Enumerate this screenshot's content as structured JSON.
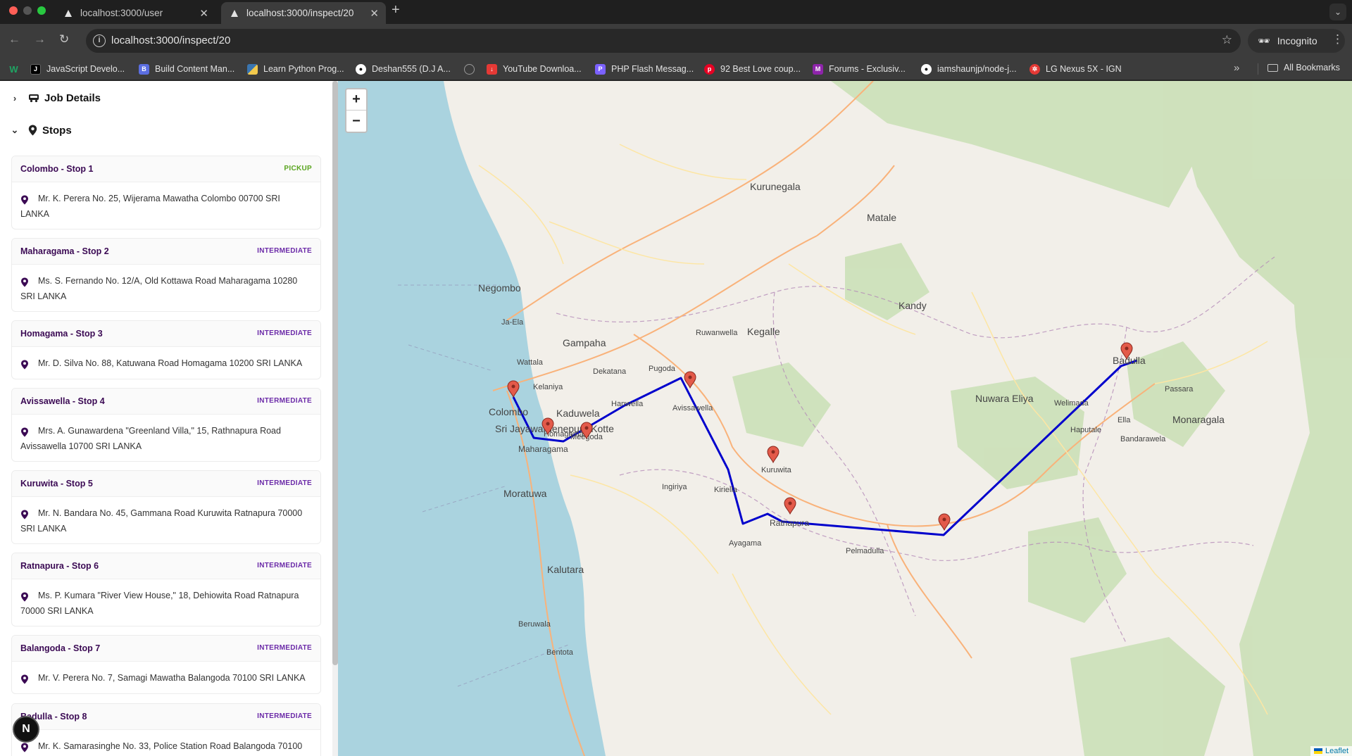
{
  "browser": {
    "tabs": [
      {
        "title": "localhost:3000/user",
        "active": false
      },
      {
        "title": "localhost:3000/inspect/20",
        "active": true
      }
    ],
    "url": "localhost:3000/inspect/20",
    "profile": "Incognito",
    "bookmarks": [
      {
        "label": "",
        "icon": "w-icon",
        "color": "#1fa463"
      },
      {
        "label": "JavaScript Develo...",
        "icon": "js-icon",
        "color": "#000000"
      },
      {
        "label": "Build Content Man...",
        "icon": "build-icon",
        "color": "#5b6ee1"
      },
      {
        "label": "Learn Python Prog...",
        "icon": "python-icon",
        "color": "#f2c94c"
      },
      {
        "label": "Deshan555 (D.J A...",
        "icon": "github-icon",
        "color": "#ffffff"
      },
      {
        "label": "",
        "icon": "globe-icon",
        "color": "#9a9a9a"
      },
      {
        "label": "YouTube Downloa...",
        "icon": "download-icon",
        "color": "#e53935"
      },
      {
        "label": "PHP Flash Messag...",
        "icon": "php-icon",
        "color": "#7b61ff"
      },
      {
        "label": "92 Best Love coup...",
        "icon": "pinterest-icon",
        "color": "#e60023"
      },
      {
        "label": "Forums - Exclusiv...",
        "icon": "m-icon",
        "color": "#8e24aa"
      },
      {
        "label": "iamshaunjp/node-j...",
        "icon": "github-icon",
        "color": "#ffffff"
      },
      {
        "label": "LG Nexus 5X - IGN",
        "icon": "ign-icon",
        "color": "#e53935"
      }
    ],
    "all_bookmarks": "All Bookmarks"
  },
  "sidebar": {
    "job_details_label": "Job Details",
    "stops_label": "Stops",
    "stops": [
      {
        "title": "Colombo - Stop 1",
        "badge": "PICKUP",
        "address": "Mr. K. Perera No. 25, Wijerama Mawatha Colombo 00700 SRI LANKA"
      },
      {
        "title": "Maharagama - Stop 2",
        "badge": "INTERMEDIATE",
        "address": "Ms. S. Fernando No. 12/A, Old Kottawa Road Maharagama 10280 SRI LANKA"
      },
      {
        "title": "Homagama - Stop 3",
        "badge": "INTERMEDIATE",
        "address": "Mr. D. Silva No. 88, Katuwana Road Homagama 10200 SRI LANKA"
      },
      {
        "title": "Avissawella - Stop 4",
        "badge": "INTERMEDIATE",
        "address": "Mrs. A. Gunawardena \"Greenland Villa,\" 15, Rathnapura Road Avissawella 10700 SRI LANKA"
      },
      {
        "title": "Kuruwita - Stop 5",
        "badge": "INTERMEDIATE",
        "address": "Mr. N. Bandara No. 45, Gammana Road Kuruwita Ratnapura 70000 SRI LANKA"
      },
      {
        "title": "Ratnapura - Stop 6",
        "badge": "INTERMEDIATE",
        "address": "Ms. P. Kumara \"River View House,\" 18, Dehiowita Road Ratnapura 70000 SRI LANKA"
      },
      {
        "title": "Balangoda - Stop 7",
        "badge": "INTERMEDIATE",
        "address": "Mr. V. Perera No. 7, Samagi Mawatha Balangoda 70100 SRI LANKA"
      },
      {
        "title": "Badulla - Stop 8",
        "badge": "INTERMEDIATE",
        "address": "Mr. K. Samarasinghe No. 33, Police Station Road Balangoda 70100"
      }
    ],
    "avatar_letter": "N"
  },
  "map": {
    "zoom_in": "+",
    "zoom_out": "−",
    "attribution": "Leaflet",
    "route_color": "#0000cc",
    "place_labels": [
      "Kurunegala",
      "Matale",
      "Kandy",
      "Kegalle",
      "Negombo",
      "Gampaha",
      "Colombo",
      "Sri Jayawardenepura Kotte",
      "Kaduwela",
      "Maharagama",
      "Moratuwa",
      "Avissawella",
      "Kuruwita",
      "Ratnapura",
      "Nuwara Eliya",
      "Badulla",
      "Monaragala",
      "Kalutara",
      "Hanwella",
      "Pugoda",
      "Dekatana",
      "Ruwanwella",
      "Homagama",
      "Meegoda",
      "Ingiriya",
      "Kiriella",
      "Ayagama",
      "Pelmadulla",
      "Ella",
      "Passara",
      "Bandarawela",
      "Welimada",
      "Haputale",
      "Beruwala",
      "Bentota",
      "Wattala",
      "Ja-Ela",
      "Kelaniya"
    ]
  }
}
